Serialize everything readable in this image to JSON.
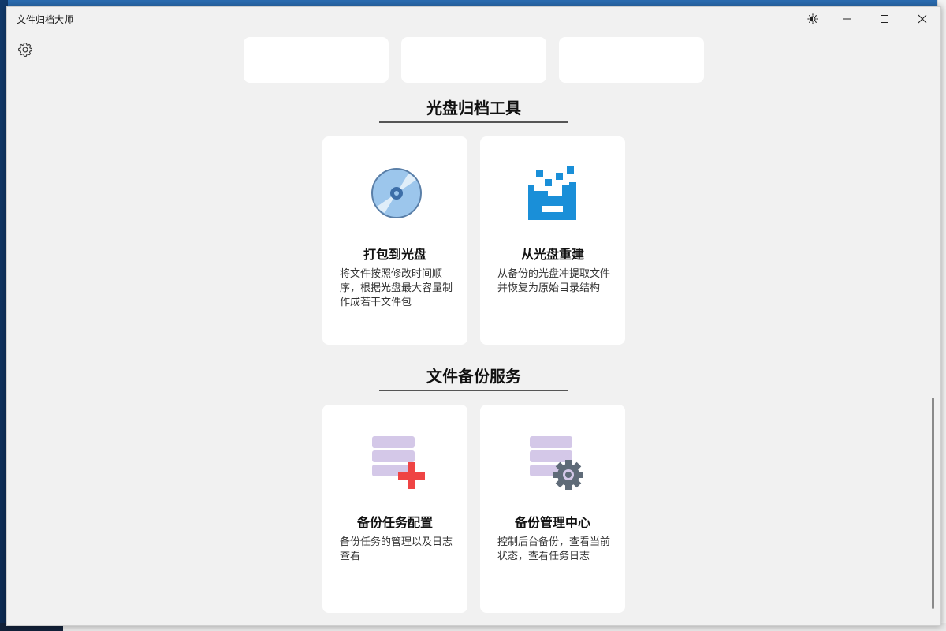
{
  "window": {
    "title": "文件归档大师"
  },
  "sections": [
    {
      "title": "光盘归档工具",
      "cards": [
        {
          "title": "打包到光盘",
          "description": "将文件按照修改时间顺序，根据光盘最大容量制作成若干文件包",
          "icon": "disc-icon"
        },
        {
          "title": "从光盘重建",
          "description": "从备份的光盘冲提取文件并恢复为原始目录结构",
          "icon": "rebuild-icon"
        }
      ]
    },
    {
      "title": "文件备份服务",
      "cards": [
        {
          "title": "备份任务配置",
          "description": "备份任务的管理以及日志查看",
          "icon": "backup-add-icon"
        },
        {
          "title": "备份管理中心",
          "description": "控制后台备份，查看当前状态，查看任务日志",
          "icon": "backup-manage-icon"
        }
      ]
    }
  ],
  "colors": {
    "window_bg": "#f1f1f1",
    "card_bg": "#ffffff",
    "disc_blue": "#9cc6ec",
    "rebuild_blue": "#1a8fd8",
    "db_purple": "#d4c8e8",
    "plus_red": "#ef4444",
    "gear_slate": "#5f6b78"
  }
}
